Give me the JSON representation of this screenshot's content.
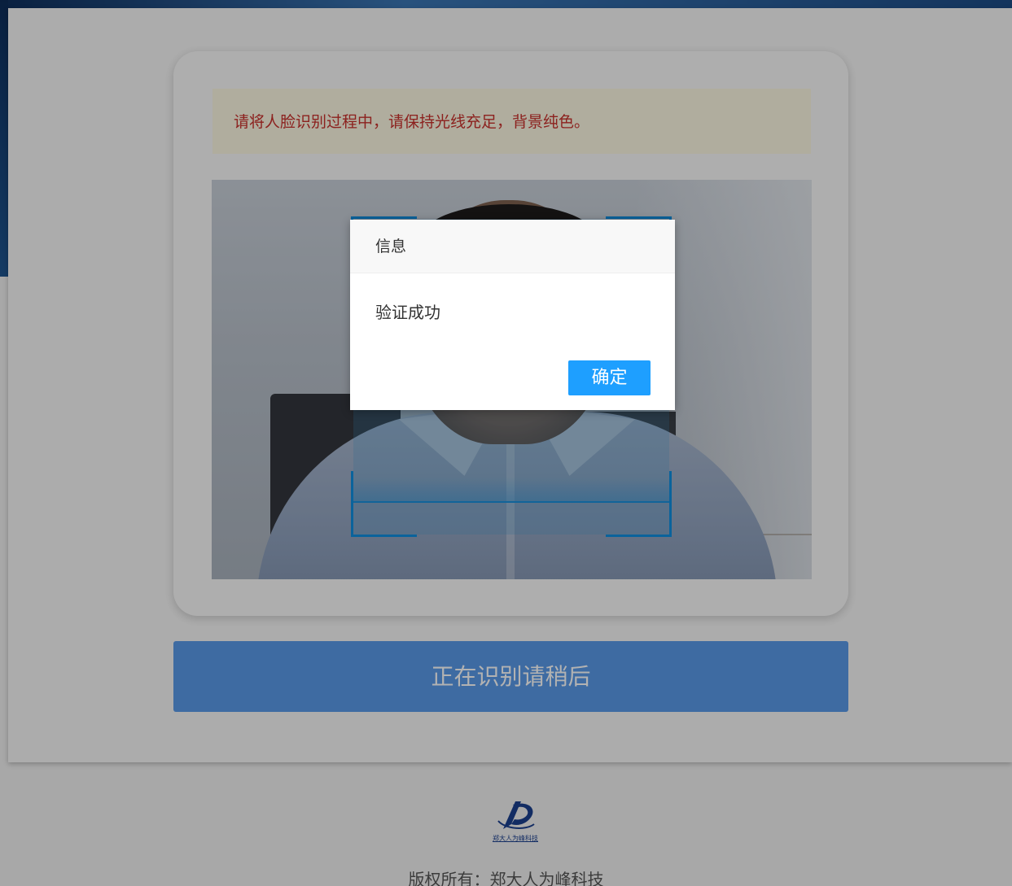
{
  "notice": {
    "text": "请将人脸识别过程中，请保持光线充足，背景纯色。"
  },
  "scan": {
    "status_label": "正在识别请稍后"
  },
  "footer": {
    "logo_text": "郑大人为峰科技",
    "copyright": "版权所有：郑大人为峰科技"
  },
  "dialog": {
    "title": "信息",
    "message": "验证成功",
    "ok_label": "确定"
  },
  "colors": {
    "notice_text": "#c9302c",
    "notice_bg": "#fcf8e3",
    "primary_button": "#5a9ae8",
    "dialog_button": "#1e9fff",
    "frame_accent": "#0f8fe0"
  }
}
